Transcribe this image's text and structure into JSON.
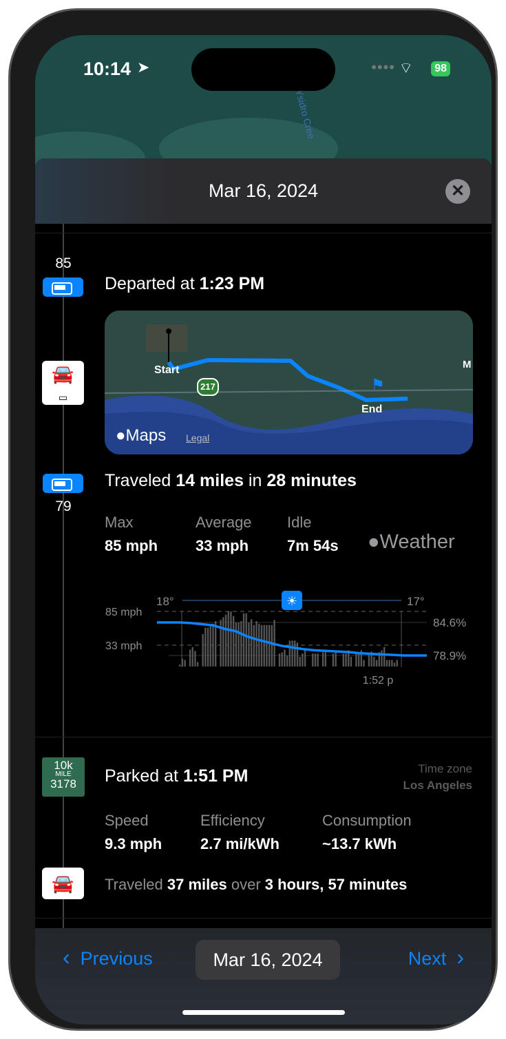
{
  "status_bar": {
    "time": "10:14",
    "battery": "98"
  },
  "map_bg": {
    "label": "n Ysidro Cree"
  },
  "sheet": {
    "title": "Mar 16, 2024"
  },
  "trip": {
    "battery_start": "85",
    "battery_end": "79",
    "departed_prefix": "Departed at ",
    "departed_time": "1:23 PM",
    "map": {
      "start": "Start",
      "end": "End",
      "route_shield": "217",
      "edge_label": "M",
      "maps_brand": "Maps",
      "legal": "Legal"
    },
    "traveled_prefix": "Traveled ",
    "traveled_distance": "14 miles",
    "traveled_mid": " in ",
    "traveled_duration": "28 minutes",
    "stats": [
      {
        "label": "Max",
        "value": "85 mph"
      },
      {
        "label": "Average",
        "value": "33 mph"
      },
      {
        "label": "Idle",
        "value": "7m 54s"
      }
    ],
    "weather_brand": "Weather"
  },
  "chart_data": {
    "type": "bar+line",
    "temp_start": "18°",
    "temp_end": "17°",
    "weather_icon": "sun-icon",
    "speed_ticks": [
      "85 mph",
      "33 mph"
    ],
    "battery_ticks": [
      "84.6%",
      "78.9%"
    ],
    "x_label": "1:52 p",
    "speed_series": {
      "unit": "mph",
      "values": [
        3,
        12,
        10,
        0,
        26,
        30,
        24,
        7,
        0,
        50,
        60,
        60,
        64,
        66,
        70,
        0,
        72,
        76,
        80,
        85,
        85,
        78,
        68,
        68,
        70,
        82,
        82,
        68,
        73,
        64,
        70,
        66,
        64,
        64,
        64,
        64,
        64,
        72,
        0,
        20,
        22,
        26,
        17,
        40,
        40,
        40,
        37,
        15,
        20,
        25,
        0,
        0,
        20,
        20,
        20,
        0,
        22,
        22,
        0,
        0,
        20,
        25,
        0,
        0,
        20,
        20,
        25,
        15,
        0,
        20,
        22,
        25,
        10,
        0,
        20,
        23,
        15,
        10,
        22,
        25,
        30,
        10,
        10,
        10,
        6,
        10,
        0
      ]
    },
    "battery_series": {
      "unit": "%",
      "values": [
        84.6,
        84.6,
        84.6,
        84.5,
        84.3,
        84.1,
        83.5,
        83.1,
        82.2,
        81.6,
        81.1,
        80.6,
        80.3,
        80.0,
        79.8,
        79.7,
        79.6,
        79.5,
        79.3,
        79.2,
        79.1,
        79.0,
        78.9,
        78.9,
        78.9
      ]
    },
    "line_color": "#0a84ff"
  },
  "parked": {
    "odometer_top": "10k",
    "odometer_unit": "MILE",
    "odometer_bottom": "3178",
    "prefix": "Parked at ",
    "time": "1:51 PM",
    "tz_label": "Time zone",
    "tz_value": "Los Angeles",
    "stats": [
      {
        "label": "Speed",
        "value": "9.3 mph"
      },
      {
        "label": "Efficiency",
        "value": "2.7 mi/kWh"
      },
      {
        "label": "Consumption",
        "value": "~13.7 kWh"
      }
    ],
    "traveled_prefix": "Traveled ",
    "traveled_distance": "37 miles",
    "traveled_mid": " over ",
    "traveled_duration": "3 hours, 57 minutes"
  },
  "bottom_bar": {
    "previous": "Previous",
    "date": "Mar 16, 2024",
    "next": "Next"
  }
}
